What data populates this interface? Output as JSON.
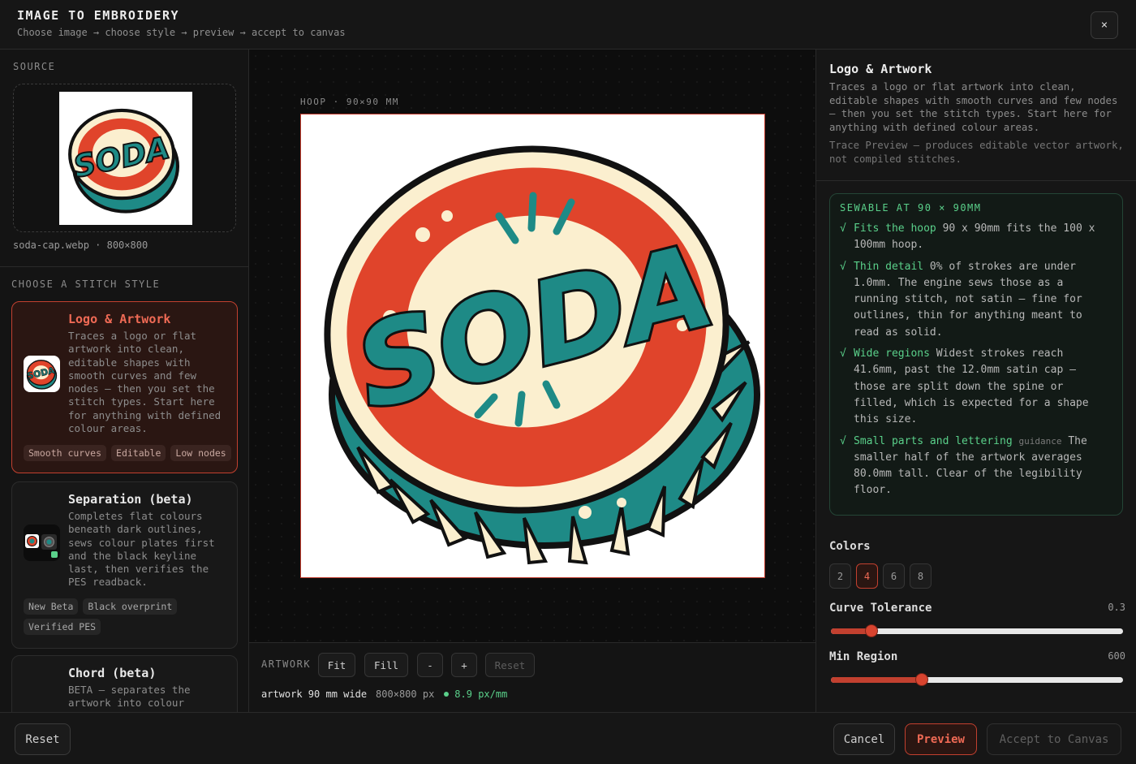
{
  "header": {
    "title": "IMAGE TO EMBROIDERY",
    "subtitle": "Choose image → choose style → preview → accept to canvas",
    "close_label": "×"
  },
  "source": {
    "label": "SOURCE",
    "filename": "soda-cap.webp · 800×800"
  },
  "styles": {
    "label": "CHOOSE A STITCH STYLE",
    "items": [
      {
        "title": "Logo & Artwork",
        "desc": "Traces a logo or flat artwork into clean, editable shapes with smooth curves and few nodes — then you set the stitch types. Start here for anything with defined colour areas.",
        "tags": [
          "Smooth curves",
          "Editable",
          "Low nodes"
        ]
      },
      {
        "title": "Separation (beta)",
        "desc": "Completes flat colours beneath dark outlines, sews colour plates first and the black keyline last, then verifies the PES readback.",
        "tags": [
          "New Beta",
          "Black overprint",
          "Verified PES"
        ]
      },
      {
        "title": "Chord (beta)",
        "desc": "BETA — separates the artwork into colour",
        "tags": []
      }
    ]
  },
  "canvas": {
    "hoop_label": "HOOP · 90×90 MM",
    "artwork_label": "ARTWORK",
    "buttons": {
      "fit": "Fit",
      "fill": "Fill",
      "minus": "-",
      "plus": "+",
      "reset": "Reset"
    },
    "meta_width": "artwork 90 mm wide",
    "meta_px": "800×800 px",
    "meta_density": "8.9 px/mm",
    "logo_text": "SODA"
  },
  "panel": {
    "title": "Logo & Artwork",
    "desc": "Traces a logo or flat artwork into clean, editable shapes with smooth curves and few nodes — then you set the stitch types. Start here for anything with defined colour areas.",
    "note": "Trace Preview — produces editable vector artwork, not compiled stitches.",
    "sewable": {
      "heading": "SEWABLE AT 90 × 90MM",
      "checks": [
        {
          "title": "Fits the hoop",
          "tag": "",
          "text": "90 x 90mm fits the 100 x 100mm hoop."
        },
        {
          "title": "Thin detail",
          "tag": "",
          "text": "0% of strokes are under 1.0mm. The engine sews those as a running stitch, not satin — fine for outlines, thin for anything meant to read as solid."
        },
        {
          "title": "Wide regions",
          "tag": "",
          "text": "Widest strokes reach 41.6mm, past the 12.0mm satin cap — those are split down the spine or filled, which is expected for a shape this size."
        },
        {
          "title": "Small parts and lettering",
          "tag": "guidance",
          "text": "The smaller half of the artwork averages 80.0mm tall. Clear of the legibility floor."
        }
      ]
    },
    "colors": {
      "label": "Colors",
      "options": [
        "2",
        "4",
        "6",
        "8"
      ],
      "selected": "4"
    },
    "curve_tolerance": {
      "label": "Curve Tolerance",
      "value": "0.3",
      "fraction": 0.14
    },
    "min_region": {
      "label": "Min Region",
      "value": "600",
      "fraction": 0.31
    }
  },
  "footer": {
    "reset": "Reset",
    "cancel": "Cancel",
    "preview": "Preview",
    "accept": "Accept to Canvas"
  },
  "colors": {
    "accent": "#c2402f",
    "accent_text": "#ef6a55",
    "success": "#5ad08a",
    "logo_teal": "#1e8a86",
    "logo_red": "#e0442b",
    "logo_cream": "#fbefcf"
  }
}
